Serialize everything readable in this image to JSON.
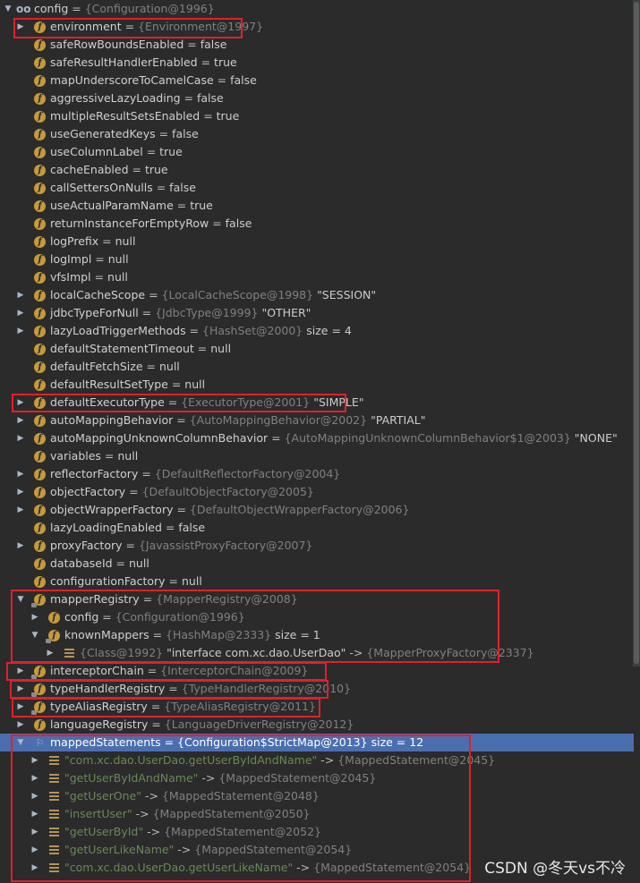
{
  "root": {
    "name": "config",
    "type": "{Configuration@1996}"
  },
  "rows": [
    {
      "indent": 1,
      "arrow": "right",
      "icon": "f",
      "name": "environment",
      "type": "{Environment@1997}"
    },
    {
      "indent": 1,
      "icon": "f",
      "name": "safeRowBoundsEnabled",
      "value": "false"
    },
    {
      "indent": 1,
      "icon": "f",
      "name": "safeResultHandlerEnabled",
      "value": "true"
    },
    {
      "indent": 1,
      "icon": "f",
      "name": "mapUnderscoreToCamelCase",
      "value": "false"
    },
    {
      "indent": 1,
      "icon": "f",
      "name": "aggressiveLazyLoading",
      "value": "false"
    },
    {
      "indent": 1,
      "icon": "f",
      "name": "multipleResultSetsEnabled",
      "value": "true"
    },
    {
      "indent": 1,
      "icon": "f",
      "name": "useGeneratedKeys",
      "value": "false"
    },
    {
      "indent": 1,
      "icon": "f",
      "name": "useColumnLabel",
      "value": "true"
    },
    {
      "indent": 1,
      "icon": "f",
      "name": "cacheEnabled",
      "value": "true"
    },
    {
      "indent": 1,
      "icon": "f",
      "name": "callSettersOnNulls",
      "value": "false"
    },
    {
      "indent": 1,
      "icon": "f",
      "name": "useActualParamName",
      "value": "true"
    },
    {
      "indent": 1,
      "icon": "f",
      "name": "returnInstanceForEmptyRow",
      "value": "false"
    },
    {
      "indent": 1,
      "icon": "f",
      "name": "logPrefix",
      "value": "null"
    },
    {
      "indent": 1,
      "icon": "f",
      "name": "logImpl",
      "value": "null"
    },
    {
      "indent": 1,
      "icon": "f",
      "name": "vfsImpl",
      "value": "null"
    },
    {
      "indent": 1,
      "arrow": "right",
      "icon": "f",
      "name": "localCacheScope",
      "type": "{LocalCacheScope@1998}",
      "value": "\"SESSION\""
    },
    {
      "indent": 1,
      "arrow": "right",
      "icon": "f",
      "name": "jdbcTypeForNull",
      "type": "{JdbcType@1999}",
      "value": "\"OTHER\""
    },
    {
      "indent": 1,
      "arrow": "right",
      "icon": "f",
      "name": "lazyLoadTriggerMethods",
      "type": "{HashSet@2000}",
      "value": " size = 4"
    },
    {
      "indent": 1,
      "icon": "f",
      "name": "defaultStatementTimeout",
      "value": "null"
    },
    {
      "indent": 1,
      "icon": "f",
      "name": "defaultFetchSize",
      "value": "null"
    },
    {
      "indent": 1,
      "icon": "f",
      "name": "defaultResultSetType",
      "value": "null"
    },
    {
      "indent": 1,
      "arrow": "right",
      "icon": "f",
      "name": "defaultExecutorType",
      "type": "{ExecutorType@2001}",
      "value": "\"SIMPLE\""
    },
    {
      "indent": 1,
      "arrow": "right",
      "icon": "f",
      "name": "autoMappingBehavior",
      "type": "{AutoMappingBehavior@2002}",
      "value": "\"PARTIAL\""
    },
    {
      "indent": 1,
      "arrow": "right",
      "icon": "f",
      "name": "autoMappingUnknownColumnBehavior",
      "type": "{AutoMappingUnknownColumnBehavior$1@2003}",
      "value": "\"NONE\""
    },
    {
      "indent": 1,
      "icon": "f",
      "name": "variables",
      "value": "null"
    },
    {
      "indent": 1,
      "arrow": "right",
      "icon": "f",
      "name": "reflectorFactory",
      "type": "{DefaultReflectorFactory@2004}"
    },
    {
      "indent": 1,
      "arrow": "right",
      "icon": "f",
      "name": "objectFactory",
      "type": "{DefaultObjectFactory@2005}"
    },
    {
      "indent": 1,
      "arrow": "right",
      "icon": "f",
      "name": "objectWrapperFactory",
      "type": "{DefaultObjectWrapperFactory@2006}"
    },
    {
      "indent": 1,
      "icon": "f",
      "name": "lazyLoadingEnabled",
      "value": "false"
    },
    {
      "indent": 1,
      "arrow": "right",
      "icon": "f",
      "name": "proxyFactory",
      "type": "{JavassistProxyFactory@2007}"
    },
    {
      "indent": 1,
      "icon": "f",
      "name": "databaseId",
      "value": "null"
    },
    {
      "indent": 1,
      "icon": "f",
      "name": "configurationFactory",
      "value": "null"
    },
    {
      "indent": 1,
      "arrow": "down",
      "icon": "f-lock",
      "name": "mapperRegistry",
      "type": "{MapperRegistry@2008}"
    },
    {
      "indent": 2,
      "arrow": "right",
      "icon": "f",
      "name": "config",
      "type": "{Configuration@1996}"
    },
    {
      "indent": 2,
      "arrow": "down",
      "icon": "f-lock",
      "name": "knownMappers",
      "type": "{HashMap@2333}",
      "value": " size = 1"
    },
    {
      "indent": 3,
      "arrow": "right",
      "icon": "lines",
      "type": "{Class@1992}",
      "value": "\"interface com.xc.dao.UserDao\"",
      "arrowtext": " -> ",
      "type2": "{MapperProxyFactory@2337}"
    },
    {
      "indent": 1,
      "arrow": "right",
      "icon": "f-lock",
      "name": "interceptorChain",
      "type": "{InterceptorChain@2009}"
    },
    {
      "indent": 1,
      "arrow": "right",
      "icon": "f-lock",
      "name": "typeHandlerRegistry",
      "type": "{TypeHandlerRegistry@2010}"
    },
    {
      "indent": 1,
      "arrow": "right",
      "icon": "f-lock",
      "name": "typeAliasRegistry",
      "type": "{TypeAliasRegistry@2011}"
    },
    {
      "indent": 1,
      "arrow": "right",
      "icon": "f",
      "name": "languageRegistry",
      "type": "{LanguageDriverRegistry@2012}"
    },
    {
      "indent": 1,
      "arrow": "down",
      "icon": "flag",
      "name": "mappedStatements",
      "type": "{Configuration$StrictMap@2013}",
      "value": " size = 12",
      "selected": true
    },
    {
      "indent": 2,
      "arrow": "right",
      "icon": "lines",
      "str": "\"com.xc.dao.UserDao.getUserByIdAndName\"",
      "arrowtext": " -> ",
      "type2": "{MappedStatement@2045}"
    },
    {
      "indent": 2,
      "arrow": "right",
      "icon": "lines",
      "str": "\"getUserByIdAndName\"",
      "arrowtext": " -> ",
      "type2": "{MappedStatement@2045}"
    },
    {
      "indent": 2,
      "arrow": "right",
      "icon": "lines",
      "str": "\"getUserOne\"",
      "arrowtext": " -> ",
      "type2": "{MappedStatement@2048}"
    },
    {
      "indent": 2,
      "arrow": "right",
      "icon": "lines",
      "str": "\"insertUser\"",
      "arrowtext": " -> ",
      "type2": "{MappedStatement@2050}"
    },
    {
      "indent": 2,
      "arrow": "right",
      "icon": "lines",
      "str": "\"getUserById\"",
      "arrowtext": " -> ",
      "type2": "{MappedStatement@2052}"
    },
    {
      "indent": 2,
      "arrow": "right",
      "icon": "lines",
      "str": "\"getUserLikeName\"",
      "arrowtext": " -> ",
      "type2": "{MappedStatement@2054}"
    },
    {
      "indent": 2,
      "arrow": "right",
      "icon": "lines",
      "str": "\"com.xc.dao.UserDao.getUserLikeName\"",
      "arrowtext": " -> ",
      "type2": "{MappedStatement@2054}"
    }
  ],
  "watermark": "CSDN @冬天vs不冷",
  "colors": {
    "background": "#2b2b2b",
    "selection": "#4b6eaf",
    "highlight_box": "#e0202a",
    "field_icon": "#c69a3a",
    "string": "#6a8759"
  }
}
